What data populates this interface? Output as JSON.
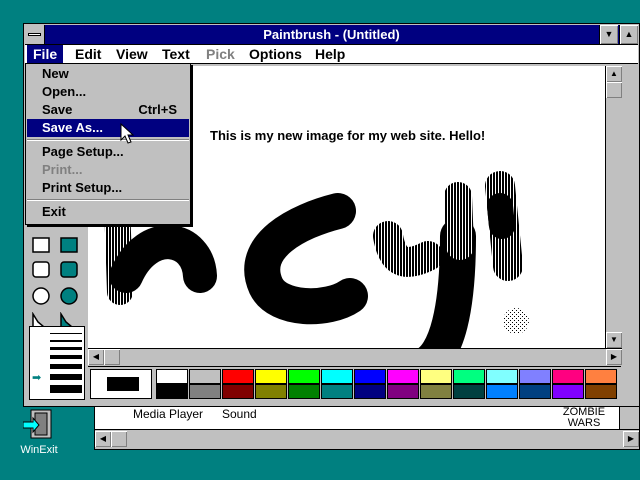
{
  "window": {
    "title": "Paintbrush - (Untitled)"
  },
  "menubar": [
    {
      "label": "File",
      "state": "selected"
    },
    {
      "label": "Edit",
      "state": "normal"
    },
    {
      "label": "View",
      "state": "normal"
    },
    {
      "label": "Text",
      "state": "normal"
    },
    {
      "label": "Pick",
      "state": "disabled"
    },
    {
      "label": "Options",
      "state": "normal"
    },
    {
      "label": "Help",
      "state": "normal"
    }
  ],
  "file_menu": [
    {
      "label": "New",
      "shortcut": "",
      "state": "normal"
    },
    {
      "label": "Open...",
      "shortcut": "",
      "state": "normal"
    },
    {
      "label": "Save",
      "shortcut": "Ctrl+S",
      "state": "normal"
    },
    {
      "label": "Save As...",
      "shortcut": "",
      "state": "highlighted"
    },
    {
      "label": "Page Setup...",
      "shortcut": "",
      "state": "normal"
    },
    {
      "label": "Print...",
      "shortcut": "",
      "state": "disabled"
    },
    {
      "label": "Print Setup...",
      "shortcut": "",
      "state": "normal"
    },
    {
      "label": "Exit",
      "shortcut": "",
      "state": "normal"
    }
  ],
  "canvas": {
    "text": "This is my new image for my web site. Hello!",
    "drawing_word": "hey!"
  },
  "palette": {
    "foreground": "#000000",
    "background": "#ffffff",
    "colors": [
      "#ffffff",
      "#c0c0c0",
      "#ff0000",
      "#ffff00",
      "#00ff00",
      "#00ffff",
      "#0000ff",
      "#ff00ff",
      "#ffff80",
      "#00ff80",
      "#80ffff",
      "#8080ff",
      "#ff0080",
      "#ff8040",
      "#000000",
      "#808080",
      "#800000",
      "#808000",
      "#008000",
      "#008080",
      "#000080",
      "#800080",
      "#808040",
      "#004040",
      "#0080ff",
      "#004080",
      "#8000ff",
      "#804000"
    ]
  },
  "background_window": {
    "items": [
      "Media Player",
      "Sound",
      "ZOMBIE WARS"
    ]
  },
  "desktop_icon": {
    "label": "WinExit"
  },
  "colors": {
    "desktop": "#008080",
    "titlebar": "#000080",
    "highlight": "#000080"
  }
}
